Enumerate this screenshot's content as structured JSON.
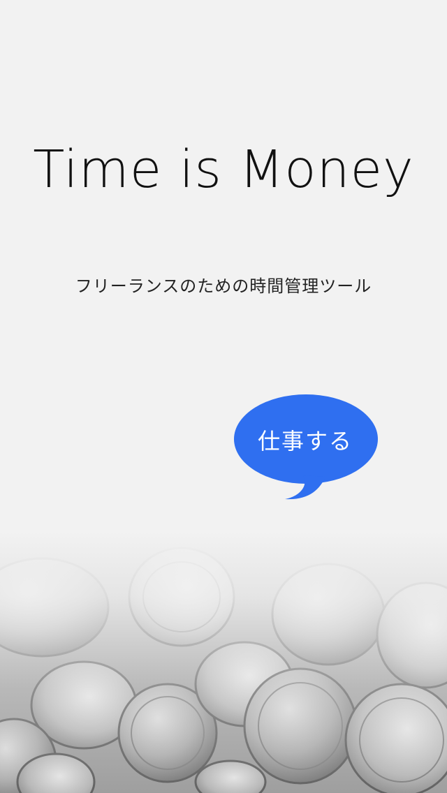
{
  "app": {
    "title": "Time is Money",
    "tagline": "フリーランスのための時間管理ツール"
  },
  "actions": {
    "work_label": "仕事する"
  },
  "colors": {
    "background": "#f2f2f2",
    "bubble": "#2f6ff0",
    "bubble_text": "#ffffff",
    "title_text": "#111111"
  },
  "background_image": {
    "subject": "coins-icon"
  }
}
